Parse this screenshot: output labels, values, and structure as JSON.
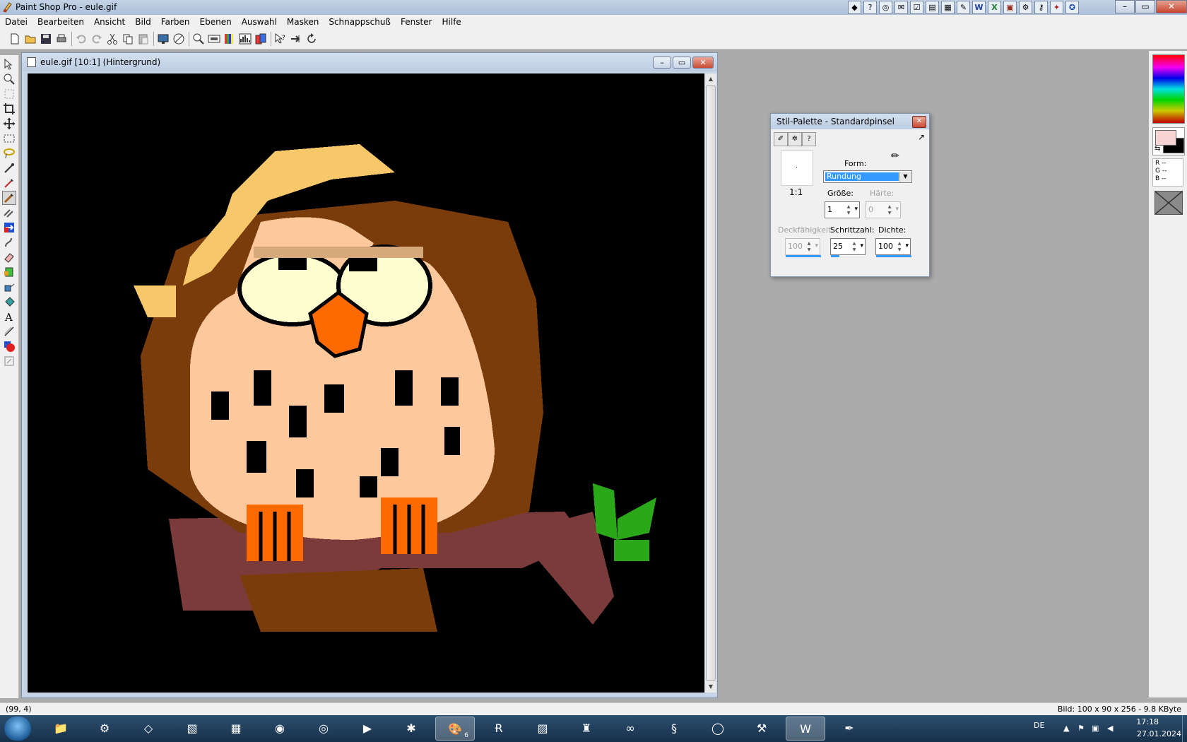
{
  "window": {
    "title": "Paint Shop Pro - eule.gif"
  },
  "menu": [
    "Datei",
    "Bearbeiten",
    "Ansicht",
    "Bild",
    "Farben",
    "Ebenen",
    "Auswahl",
    "Masken",
    "Schnappschuß",
    "Fenster",
    "Hilfe"
  ],
  "document": {
    "title": "eule.gif [10:1] (Hintergrund)"
  },
  "stil_palette": {
    "title": "Stil-Palette - Standardpinsel",
    "ratio": "1:1",
    "form_label": "Form:",
    "form_value": "Rundung",
    "groesse_label": "Größe:",
    "groesse_value": "1",
    "haerte_label": "Härte:",
    "haerte_value": "0",
    "deckfaehigkeit_label": "Deckfähigkeit:",
    "deckfaehigkeit_value": "100",
    "schrittzahl_label": "Schrittzahl:",
    "schrittzahl_value": "25",
    "dichte_label": "Dichte:",
    "dichte_value": "100"
  },
  "color_panel": {
    "rgb": [
      "R --",
      "G --",
      "B --"
    ],
    "foreground": "#f6d4d4",
    "background": "#000000"
  },
  "status": {
    "coords": "(99, 4)",
    "info": "Bild: 100 x 90 x 256 - 9.8 KByte"
  },
  "taskbar": {
    "lang": "DE",
    "time": "17:18",
    "date": "27.01.2024",
    "paint_badge": "6"
  },
  "colors": {
    "owl_brown": "#7a3c0a",
    "owl_spot": "#b84a12",
    "face": "#fdc99c",
    "eye": "#fdfdd0",
    "beak": "#ff6a00",
    "hat": "#f7c86a",
    "branch": "#7c3b3b",
    "leaf": "#2aa81a"
  }
}
